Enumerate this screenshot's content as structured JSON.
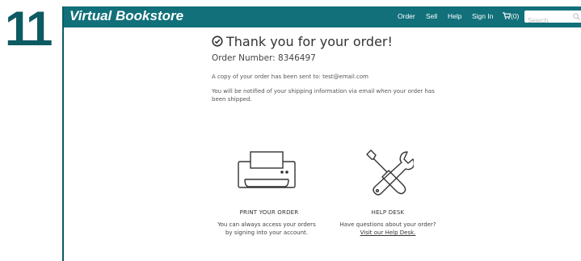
{
  "step": {
    "number": "11"
  },
  "header": {
    "brand": "Virtual Bookstore",
    "nav": {
      "order": "Order",
      "sell": "Sell",
      "help": "Help",
      "sign_in": "Sign In"
    },
    "cart_count": "(0)",
    "search_placeholder": "Search"
  },
  "confirmation": {
    "title": "Thank you for your order!",
    "order_number": "Order Number: 8346497",
    "copy_note": "A copy of your order has been sent to: test@email.com",
    "shipping_note": "You will be notified of your shipping information via email when your order has been shipped."
  },
  "print_section": {
    "heading": "PRINT YOUR ORDER",
    "line1": "You can always access your orders",
    "line2": "by signing into your account."
  },
  "help_section": {
    "heading": "HELP DESK",
    "line1": "Have questions about your order?",
    "link": "Visit our Help Desk."
  },
  "colors": {
    "header_bg": "#11707a",
    "accent": "#0e5a63"
  },
  "icons": [
    "check-circle-icon",
    "cart-icon",
    "search-icon",
    "printer-icon",
    "tools-icon"
  ]
}
